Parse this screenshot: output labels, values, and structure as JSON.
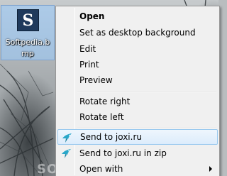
{
  "desktop": {
    "file_icon": {
      "glyph": "S",
      "filename": "Softpedia.bmp"
    },
    "watermark": "SOFTPEDIA"
  },
  "context_menu": {
    "items": [
      {
        "label": "Open",
        "bold": true
      },
      {
        "label": "Set as desktop background"
      },
      {
        "label": "Edit"
      },
      {
        "label": "Print"
      },
      {
        "label": "Preview"
      },
      {
        "label": "Rotate right"
      },
      {
        "label": "Rotate left"
      },
      {
        "label": "Send to joxi.ru",
        "icon": "joxi-bird-icon",
        "highlighted": true
      },
      {
        "label": "Send to joxi.ru in zip",
        "icon": "joxi-bird-icon"
      },
      {
        "label": "Open with",
        "submenu": true
      }
    ]
  },
  "colors": {
    "selection_bg": "#dcecfc",
    "selection_border": "#99c9ef",
    "menu_bg": "#f0f0f0",
    "icon_tile": "#1f3a5c",
    "joxi_icon": "#2aa7c9"
  }
}
